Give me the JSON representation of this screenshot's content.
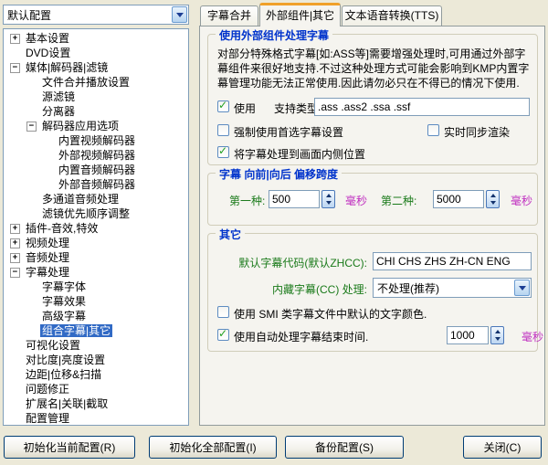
{
  "profile_combo": {
    "value": "默认配置"
  },
  "tree": {
    "items": [
      {
        "label": "基本设置",
        "depth": 0,
        "expander": "plus",
        "selected": false
      },
      {
        "label": "DVD设置",
        "depth": 0,
        "expander": null,
        "selected": false
      },
      {
        "label": "媒体|解码器|滤镜",
        "depth": 0,
        "expander": "minus",
        "selected": false
      },
      {
        "label": "文件合并播放设置",
        "depth": 1,
        "expander": null,
        "selected": false
      },
      {
        "label": "源滤镜",
        "depth": 1,
        "expander": null,
        "selected": false
      },
      {
        "label": "分离器",
        "depth": 1,
        "expander": null,
        "selected": false
      },
      {
        "label": "解码器应用选项",
        "depth": 1,
        "expander": "minus",
        "selected": false
      },
      {
        "label": "内置视频解码器",
        "depth": 2,
        "expander": null,
        "selected": false
      },
      {
        "label": "外部视频解码器",
        "depth": 2,
        "expander": null,
        "selected": false
      },
      {
        "label": "内置音频解码器",
        "depth": 2,
        "expander": null,
        "selected": false
      },
      {
        "label": "外部音频解码器",
        "depth": 2,
        "expander": null,
        "selected": false
      },
      {
        "label": "多通道音频处理",
        "depth": 1,
        "expander": null,
        "selected": false
      },
      {
        "label": "滤镜优先顺序调整",
        "depth": 1,
        "expander": null,
        "selected": false
      },
      {
        "label": "插件-音效,特效",
        "depth": 0,
        "expander": "plus",
        "selected": false
      },
      {
        "label": "视频处理",
        "depth": 0,
        "expander": "plus",
        "selected": false
      },
      {
        "label": "音频处理",
        "depth": 0,
        "expander": "plus",
        "selected": false
      },
      {
        "label": "字幕处理",
        "depth": 0,
        "expander": "minus",
        "selected": false
      },
      {
        "label": "字幕字体",
        "depth": 1,
        "expander": null,
        "selected": false
      },
      {
        "label": "字幕效果",
        "depth": 1,
        "expander": null,
        "selected": false
      },
      {
        "label": "高级字幕",
        "depth": 1,
        "expander": null,
        "selected": false
      },
      {
        "label": "组合字幕|其它",
        "depth": 1,
        "expander": null,
        "selected": true
      },
      {
        "label": "可视化设置",
        "depth": 0,
        "expander": null,
        "selected": false
      },
      {
        "label": "对比度|亮度设置",
        "depth": 0,
        "expander": null,
        "selected": false
      },
      {
        "label": "边距|位移&扫描",
        "depth": 0,
        "expander": null,
        "selected": false
      },
      {
        "label": "问题修正",
        "depth": 0,
        "expander": null,
        "selected": false
      },
      {
        "label": "扩展名|关联|截取",
        "depth": 0,
        "expander": null,
        "selected": false
      },
      {
        "label": "配置管理",
        "depth": 0,
        "expander": null,
        "selected": false
      }
    ]
  },
  "tabs": {
    "items": [
      "字幕合并",
      "外部组件|其它",
      "文本语音转换(TTS)"
    ],
    "active_index": 1
  },
  "panel": {
    "group_external": {
      "title": "使用外部组件处理字幕",
      "desc_lines": [
        "对部分特殊格式字幕[如:ASS等]需要增强处理时,可用通过外部字",
        "幕组件来很好地支持.不过这种处理方式可能会影响到KMP内置字",
        "幕管理功能无法正常使用.因此请勿必只在不得已的情况下使用."
      ],
      "use_label": "使用",
      "use_checked": true,
      "types_label": "支持类型:",
      "types_value": ".ass .ass2 .ssa .ssf",
      "force_label": "强制使用首选字幕设置",
      "force_checked": false,
      "realtime_label": "实时同步渲染",
      "realtime_checked": false,
      "inside_label": "将字幕处理到画面内侧位置",
      "inside_checked": true
    },
    "group_offset": {
      "title": "字幕 向前|向后 偏移跨度",
      "first_label": "第一种:",
      "first_value": "500",
      "first_unit": "毫秒",
      "second_label": "第二种:",
      "second_value": "5000",
      "second_unit": "毫秒"
    },
    "group_other": {
      "title": "其它",
      "codepage_label": "默认字幕代码(默认ZHCC):",
      "codepage_value": "CHI CHS ZHS ZH-CN ENG",
      "cc_label": "内藏字幕(CC) 处理:",
      "cc_value": "不处理(推荐)",
      "smi_label": "使用 SMI 类字幕文件中默认的文字颜色.",
      "smi_checked": false,
      "autoend_label": "使用自动处理字幕结束时间.",
      "autoend_checked": true,
      "autoend_value": "1000",
      "autoend_unit": "毫秒"
    }
  },
  "footer": {
    "buttons": [
      "初始化当前配置(R)",
      "初始化全部配置(I)",
      "备份配置(S)",
      "关闭(C)"
    ]
  },
  "colors": {
    "dialog_bg": "#ECE9D8",
    "panel_bg": "#F5F4EF",
    "group_title_blue": "#0033CC",
    "label_green": "#1A7A1A",
    "unit_magenta": "#C030C0",
    "selection_blue": "#316AC5",
    "check_green": "#21A121",
    "active_tab_accent": "#F0A029"
  }
}
